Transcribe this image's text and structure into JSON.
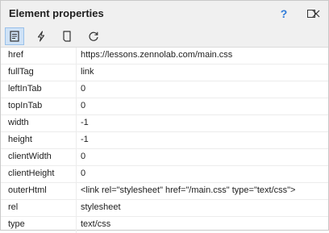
{
  "window": {
    "title": "Element properties",
    "help_label": "?"
  },
  "toolbar": {
    "tools": [
      "properties-icon",
      "lightning-icon",
      "page-icon",
      "refresh-icon"
    ]
  },
  "properties": [
    {
      "name": "href",
      "value": "https://lessons.zennolab.com/main.css"
    },
    {
      "name": "fullTag",
      "value": "link"
    },
    {
      "name": "leftInTab",
      "value": "0"
    },
    {
      "name": "topInTab",
      "value": "0"
    },
    {
      "name": "width",
      "value": "-1"
    },
    {
      "name": "height",
      "value": "-1"
    },
    {
      "name": "clientWidth",
      "value": "0"
    },
    {
      "name": "clientHeight",
      "value": "0"
    },
    {
      "name": "outerHtml",
      "value": "<link rel=\"stylesheet\" href=\"/main.css\" type=\"text/css\">"
    },
    {
      "name": "rel",
      "value": "stylesheet"
    },
    {
      "name": "type",
      "value": "text/css"
    }
  ]
}
